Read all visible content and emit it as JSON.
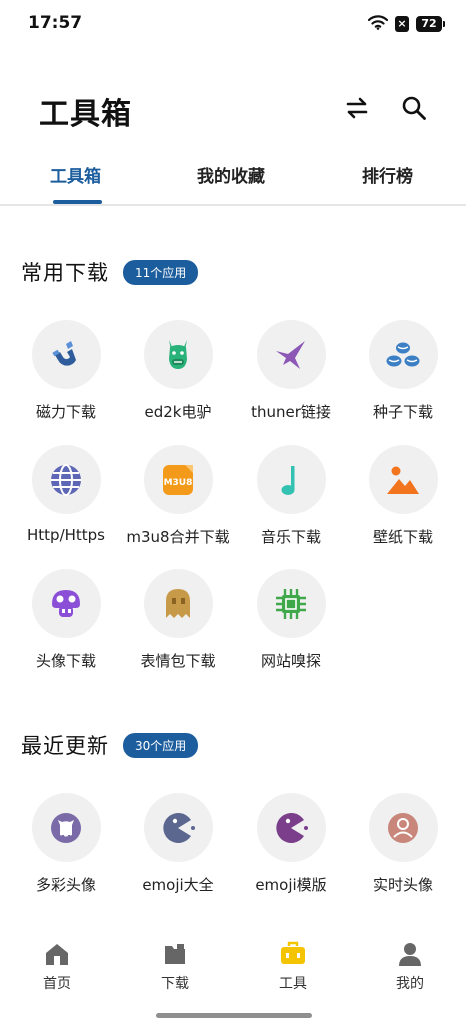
{
  "status_bar": {
    "time": "17:57",
    "battery": "72",
    "sim": "×"
  },
  "header": {
    "title": "工具箱"
  },
  "tabs": [
    {
      "label": "工具箱",
      "active": true
    },
    {
      "label": "我的收藏",
      "active": false
    },
    {
      "label": "排行榜",
      "active": false
    }
  ],
  "sections": [
    {
      "title": "常用下载",
      "badge": "11个应用",
      "apps": [
        {
          "label": "磁力下载",
          "icon": "magnet-icon",
          "color": "#2f5d9b"
        },
        {
          "label": "ed2k电驴",
          "icon": "donkey-icon",
          "color": "#2ab27b"
        },
        {
          "label": "thuner链接",
          "icon": "bird-icon",
          "color": "#8c57b5"
        },
        {
          "label": "种子下载",
          "icon": "seeds-icon",
          "color": "#3b7fc4"
        },
        {
          "label": "Http/Https",
          "icon": "globe-icon",
          "color": "#5d67b5"
        },
        {
          "label": "m3u8合并下载",
          "icon": "m3u8-icon",
          "color": "#f39a1a",
          "icon_text": "M3U8"
        },
        {
          "label": "音乐下载",
          "icon": "music-note-icon",
          "color": "#33c1b2"
        },
        {
          "label": "壁纸下载",
          "icon": "landscape-icon",
          "color": "#f2741d"
        },
        {
          "label": "头像下载",
          "icon": "mushroom-icon",
          "color": "#8a4fd6"
        },
        {
          "label": "表情包下载",
          "icon": "ghost-icon",
          "color": "#c79a4a"
        },
        {
          "label": "网站嗅探",
          "icon": "chip-icon",
          "color": "#3fa84a"
        }
      ]
    },
    {
      "title": "最近更新",
      "badge": "30个应用",
      "apps": [
        {
          "label": "多彩头像",
          "icon": "github-icon",
          "color": "#7a6aa8"
        },
        {
          "label": "emoji大全",
          "icon": "pacman-icon",
          "color": "#5c6790"
        },
        {
          "label": "emoji模版",
          "icon": "pacman-icon",
          "color": "#7a3e8a"
        },
        {
          "label": "实时头像",
          "icon": "person-icon",
          "color": "#c8877a"
        }
      ]
    }
  ],
  "bottom_nav": [
    {
      "label": "首页",
      "icon": "home-icon",
      "active": false
    },
    {
      "label": "下载",
      "icon": "folder-icon",
      "active": false
    },
    {
      "label": "工具",
      "icon": "toolbox-icon",
      "active": true
    },
    {
      "label": "我的",
      "icon": "profile-icon",
      "active": false
    }
  ],
  "colors": {
    "accent": "#1c5d9e",
    "active_nav": "#f5c400",
    "inactive_nav": "#666666"
  }
}
